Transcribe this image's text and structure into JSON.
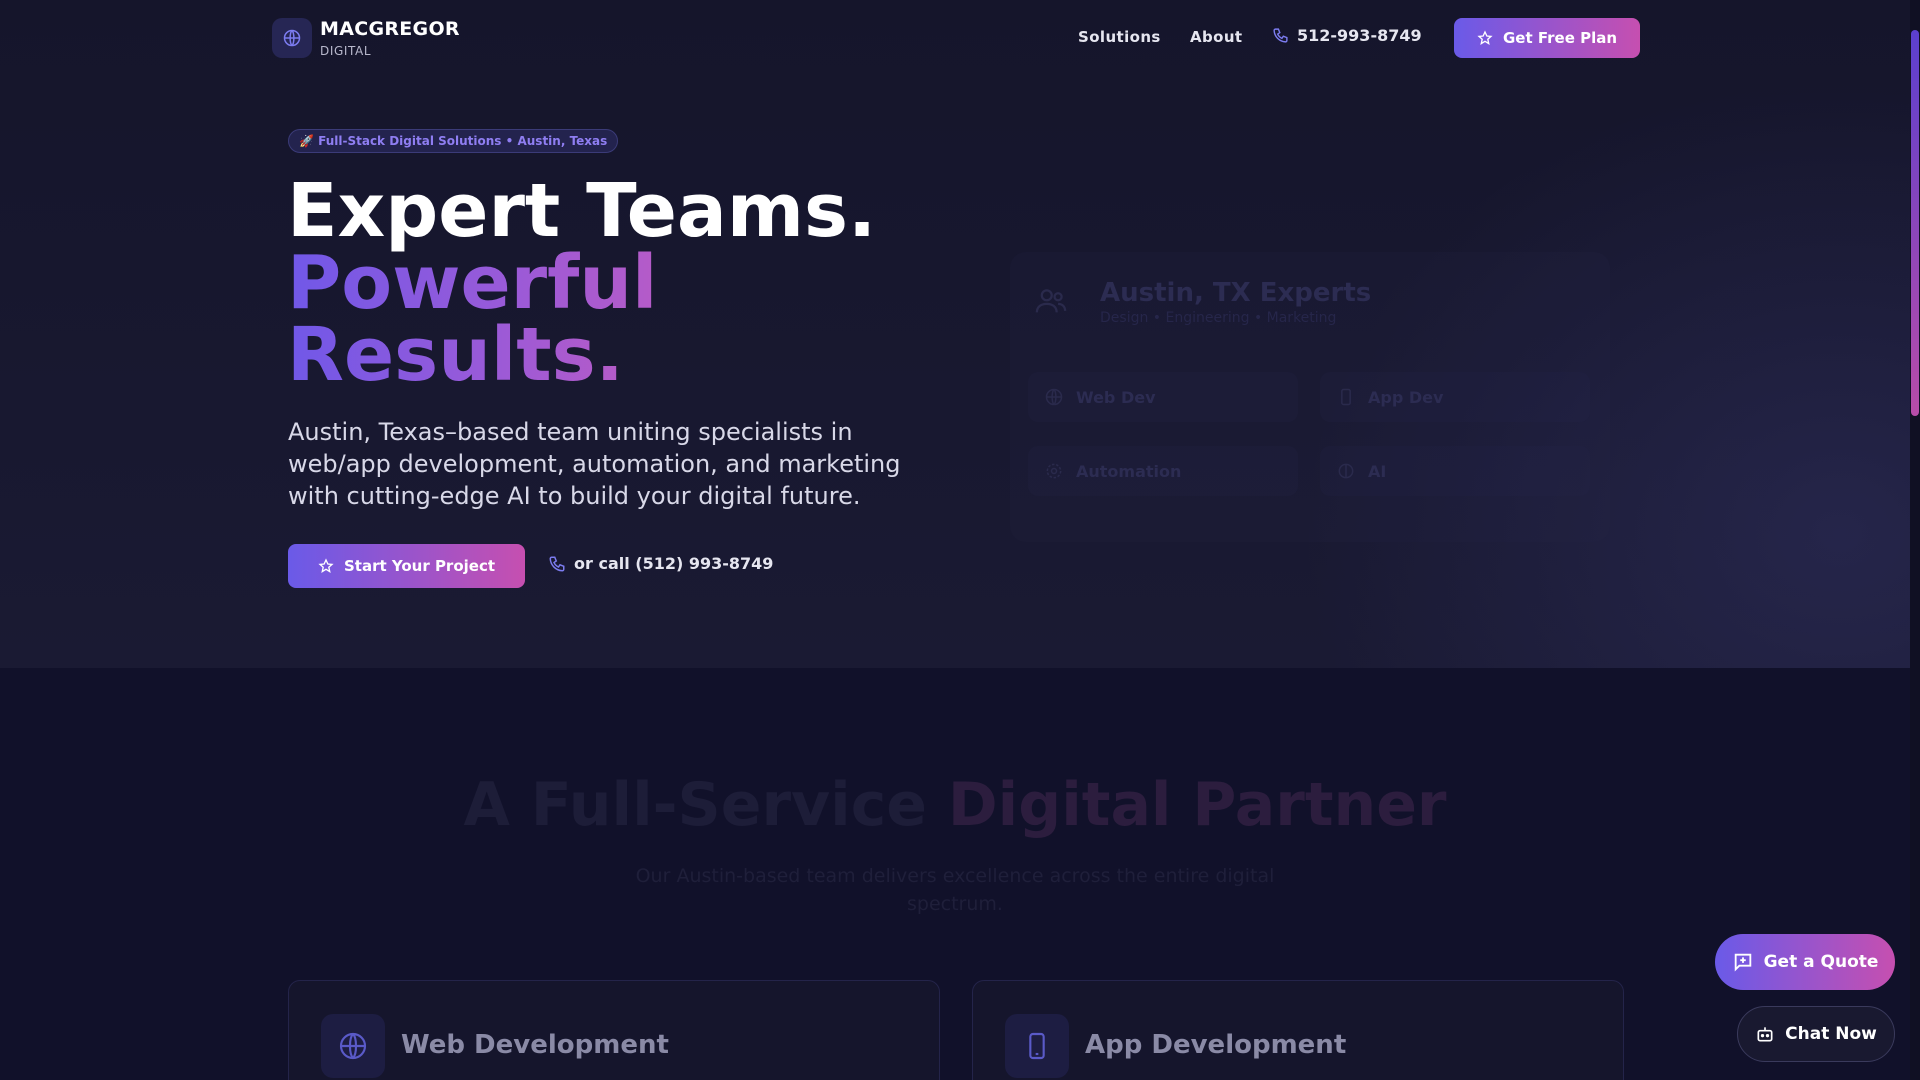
{
  "header": {
    "brand_name": "MACGREGOR",
    "brand_sub": "DIGITAL",
    "nav": [
      {
        "label": "Solutions"
      },
      {
        "label": "About"
      }
    ],
    "phone": "512-993-8749",
    "cta_label": "Get Free Plan"
  },
  "hero": {
    "badge": "🚀 Full-Stack Digital Solutions • Austin, Texas",
    "headline_1": "Expert Teams.",
    "headline_2": "Powerful",
    "headline_3": "Results.",
    "lead": "Austin, Texas–based team uniting specialists in web/app development, automation, and marketing with cutting-edge AI to build your digital future.",
    "cta_label": "Start Your Project",
    "call_label": "or call (512) 993-8749",
    "panel": {
      "title": "Austin, TX Experts",
      "subtitle": "Design • Engineering • Marketing",
      "items": [
        {
          "label": "Web Dev"
        },
        {
          "label": "App Dev"
        },
        {
          "label": "Automation"
        },
        {
          "label": "AI"
        }
      ]
    }
  },
  "services_section": {
    "title_part1": "A Full-Service ",
    "title_part2": "Digital Partner",
    "subtitle": "Our Austin-based team delivers excellence across the entire digital spectrum.",
    "cards": [
      {
        "title": "Web Development",
        "icon": "globe-icon"
      },
      {
        "title": "App Development",
        "icon": "phone-icon"
      }
    ]
  },
  "floating": {
    "quote_label": "Get a Quote",
    "chat_label": "Chat Now"
  },
  "colors": {
    "accent_start": "#6a5ae8",
    "accent_end": "#c64fb0",
    "background": "#0f0f22"
  }
}
